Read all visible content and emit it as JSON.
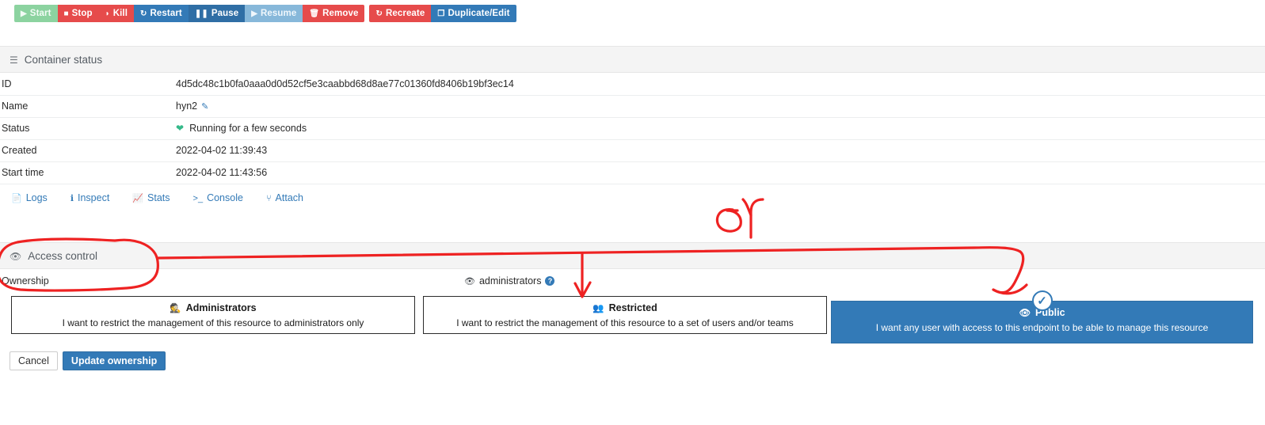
{
  "toolbar": {
    "groups": [
      {
        "buttons": [
          {
            "label": "Start",
            "icon": "play-icon",
            "glyph": "▶",
            "style": "btn-green"
          },
          {
            "label": "Stop",
            "icon": "stop-icon",
            "glyph": "■",
            "style": "btn-red"
          },
          {
            "label": "Kill",
            "icon": "bomb-icon",
            "glyph": "◗",
            "style": "btn-red"
          },
          {
            "label": "Restart",
            "icon": "refresh-icon",
            "glyph": "↻",
            "style": "btn-blue"
          },
          {
            "label": "Pause",
            "icon": "pause-icon",
            "glyph": "❚❚",
            "style": "btn-darkblue"
          },
          {
            "label": "Resume",
            "icon": "play-icon",
            "glyph": "▶",
            "style": "btn-lightblue"
          },
          {
            "label": "Remove",
            "icon": "trash-icon",
            "glyph": "🗑",
            "style": "btn-red"
          }
        ]
      },
      {
        "buttons": [
          {
            "label": "Recreate",
            "icon": "refresh-icon",
            "glyph": "↻",
            "style": "btn-red"
          },
          {
            "label": "Duplicate/Edit",
            "icon": "duplicate-icon",
            "glyph": "❐",
            "style": "btn-blue"
          }
        ]
      }
    ]
  },
  "container_status": {
    "heading": "Container status",
    "heading_icon": "server-icon",
    "rows": [
      {
        "key": "ID",
        "value": "4d5dc48c1b0fa0aaa0d0d52cf5e3caabbd68d8ae77c01360fd8406b19bf3ec14"
      },
      {
        "key": "Name",
        "value": "hyn2"
      },
      {
        "key": "Status",
        "value": "Running for a few seconds"
      },
      {
        "key": "Created",
        "value": "2022-04-02 11:39:43"
      },
      {
        "key": "Start time",
        "value": "2022-04-02 11:43:56"
      }
    ],
    "name_edit_icon": "edit-icon",
    "status_icon": "heartbeat-icon",
    "status_icon_color": "#35b98a",
    "links": [
      {
        "label": "Logs",
        "icon": "file-icon",
        "glyph": "📄"
      },
      {
        "label": "Inspect",
        "icon": "info-icon",
        "glyph": "ℹ"
      },
      {
        "label": "Stats",
        "icon": "chart-icon",
        "glyph": "📈"
      },
      {
        "label": "Console",
        "icon": "terminal-icon",
        "glyph": ">_"
      },
      {
        "label": "Attach",
        "icon": "plug-icon",
        "glyph": "⑂"
      }
    ]
  },
  "access_control": {
    "heading": "Access control",
    "heading_icon": "eye-icon",
    "ownership_label": "Ownership",
    "ownership_value": "administrators",
    "ownership_value_icon": "eye-icon",
    "help_icon": "question-icon",
    "options": [
      {
        "title": "Administrators",
        "icon": "user-secret-icon",
        "glyph": "🕵",
        "description": "I want to restrict the management of this resource to administrators only",
        "selected": false
      },
      {
        "title": "Restricted",
        "icon": "users-icon",
        "glyph": "👥",
        "description": "I want to restrict the management of this resource to a set of users and/or teams",
        "selected": false
      },
      {
        "title": "Public",
        "icon": "eye-icon",
        "glyph": "👁",
        "description": "I want any user with access to this endpoint to be able to manage this resource",
        "selected": true
      }
    ],
    "selected_badge_icon": "check-circle-icon",
    "selected_badge_glyph": "✓",
    "cancel_label": "Cancel",
    "submit_label": "Update ownership"
  },
  "annotations": {
    "color": "#ee2222",
    "marks": [
      "circle-around-access-control",
      "long-horizontal-line",
      "arrow-down-left",
      "arrow-down-right",
      "scribble-mark"
    ]
  },
  "colors": {
    "primary": "#337ab7",
    "danger": "#e64b4b",
    "success": "#8cd3a0",
    "panel_head_bg": "#f4f4f4",
    "annotation_red": "#ee2222"
  }
}
